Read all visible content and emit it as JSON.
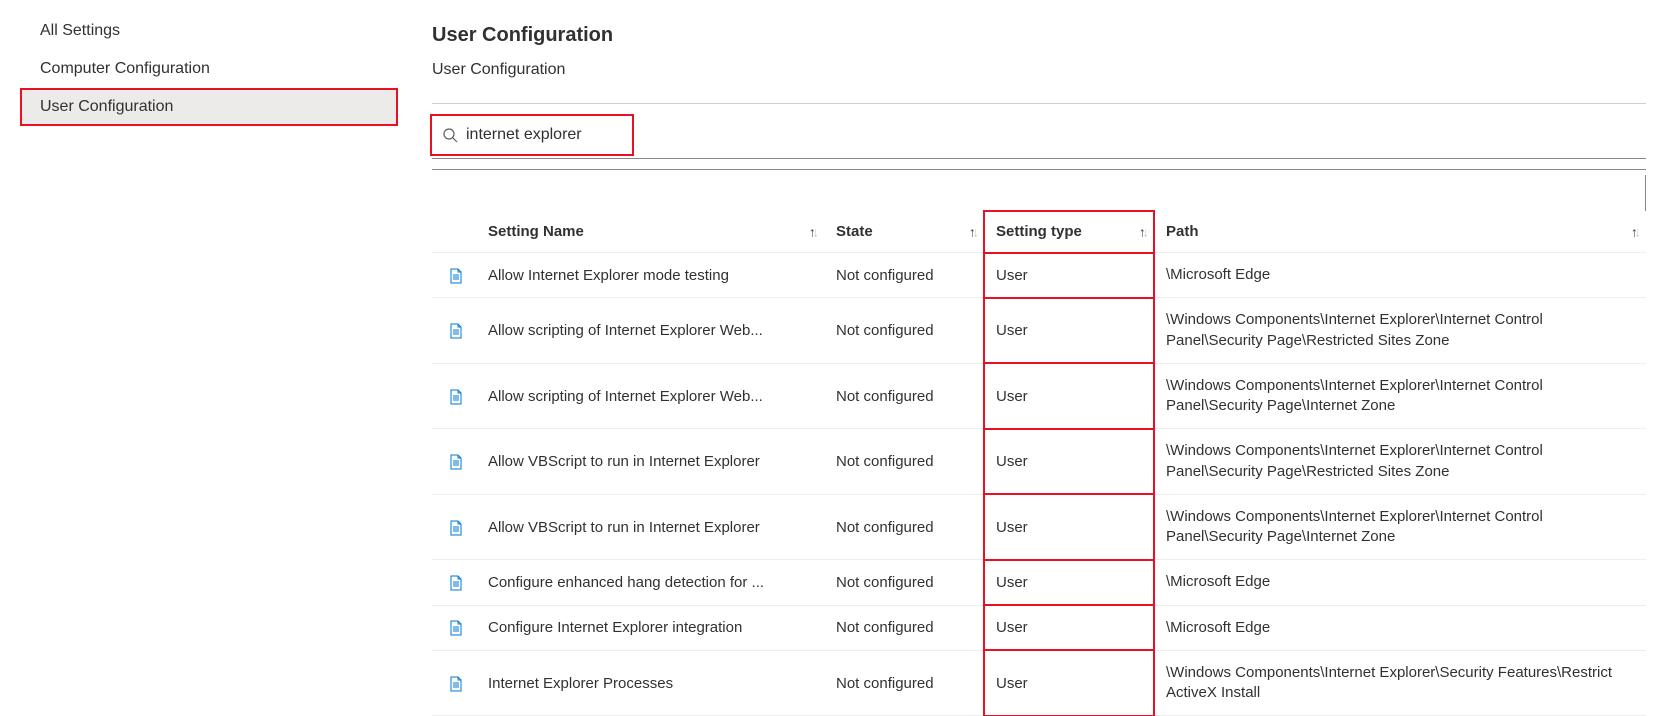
{
  "sidebar": {
    "items": [
      {
        "label": "All Settings",
        "selected": false,
        "highlighted": false
      },
      {
        "label": "Computer Configuration",
        "selected": false,
        "highlighted": false
      },
      {
        "label": "User Configuration",
        "selected": true,
        "highlighted": true
      }
    ]
  },
  "header": {
    "title": "User Configuration",
    "breadcrumb": "User Configuration"
  },
  "search": {
    "value": "internet explorer",
    "icon": "search-icon"
  },
  "table": {
    "columns": [
      {
        "key": "name",
        "label": "Setting Name",
        "sortable": true,
        "highlighted": false
      },
      {
        "key": "state",
        "label": "State",
        "sortable": true,
        "highlighted": false
      },
      {
        "key": "type",
        "label": "Setting type",
        "sortable": true,
        "highlighted": true
      },
      {
        "key": "path",
        "label": "Path",
        "sortable": true,
        "highlighted": false
      }
    ],
    "rows": [
      {
        "name": "Allow Internet Explorer mode testing",
        "state": "Not configured",
        "type": "User",
        "path": "\\Microsoft Edge"
      },
      {
        "name": "Allow scripting of Internet Explorer Web...",
        "state": "Not configured",
        "type": "User",
        "path": "\\Windows Components\\Internet Explorer\\Internet Control Panel\\Security Page\\Restricted Sites Zone"
      },
      {
        "name": "Allow scripting of Internet Explorer Web...",
        "state": "Not configured",
        "type": "User",
        "path": "\\Windows Components\\Internet Explorer\\Internet Control Panel\\Security Page\\Internet Zone"
      },
      {
        "name": "Allow VBScript to run in Internet Explorer",
        "state": "Not configured",
        "type": "User",
        "path": "\\Windows Components\\Internet Explorer\\Internet Control Panel\\Security Page\\Restricted Sites Zone"
      },
      {
        "name": "Allow VBScript to run in Internet Explorer",
        "state": "Not configured",
        "type": "User",
        "path": "\\Windows Components\\Internet Explorer\\Internet Control Panel\\Security Page\\Internet Zone"
      },
      {
        "name": "Configure enhanced hang detection for ...",
        "state": "Not configured",
        "type": "User",
        "path": "\\Microsoft Edge"
      },
      {
        "name": "Configure Internet Explorer integration",
        "state": "Not configured",
        "type": "User",
        "path": "\\Microsoft Edge"
      },
      {
        "name": "Internet Explorer Processes",
        "state": "Not configured",
        "type": "User",
        "path": "\\Windows Components\\Internet Explorer\\Security Features\\Restrict ActiveX Install"
      }
    ]
  }
}
